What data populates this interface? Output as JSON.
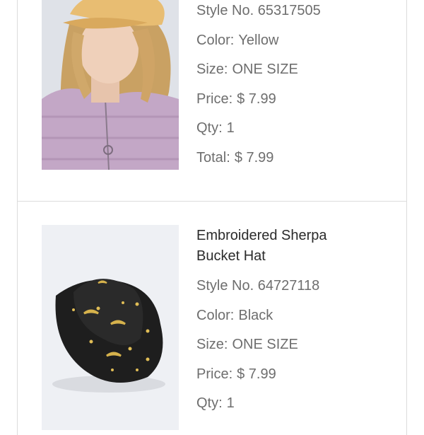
{
  "items": [
    {
      "image_alt": "Woman wearing a yellow corduroy baker boy cap and lilac cable-knit zip sweater",
      "style_label": "Style No.",
      "style_value": "65317505",
      "color_label": "Color:",
      "color_value": "Yellow",
      "size_label": "Size:",
      "size_value": "ONE SIZE",
      "price_label": "Price:",
      "price_value": "$ 7.99",
      "qty_label": "Qty:",
      "qty_value": "1",
      "total_label": "Total:",
      "total_value": "$ 7.99"
    },
    {
      "title": "Embroidered Sherpa Bucket Hat",
      "image_alt": "Black sherpa bucket hat embroidered with gold moons and stars",
      "style_label": "Style No.",
      "style_value": "64727118",
      "color_label": "Color:",
      "color_value": "Black",
      "size_label": "Size:",
      "size_value": "ONE SIZE",
      "price_label": "Price:",
      "price_value": "$ 7.99",
      "qty_label": "Qty:",
      "qty_value": "1"
    }
  ],
  "colors": {
    "text": "#6e6e6e",
    "title": "#2b2b2b",
    "border": "#dcdcdc"
  }
}
